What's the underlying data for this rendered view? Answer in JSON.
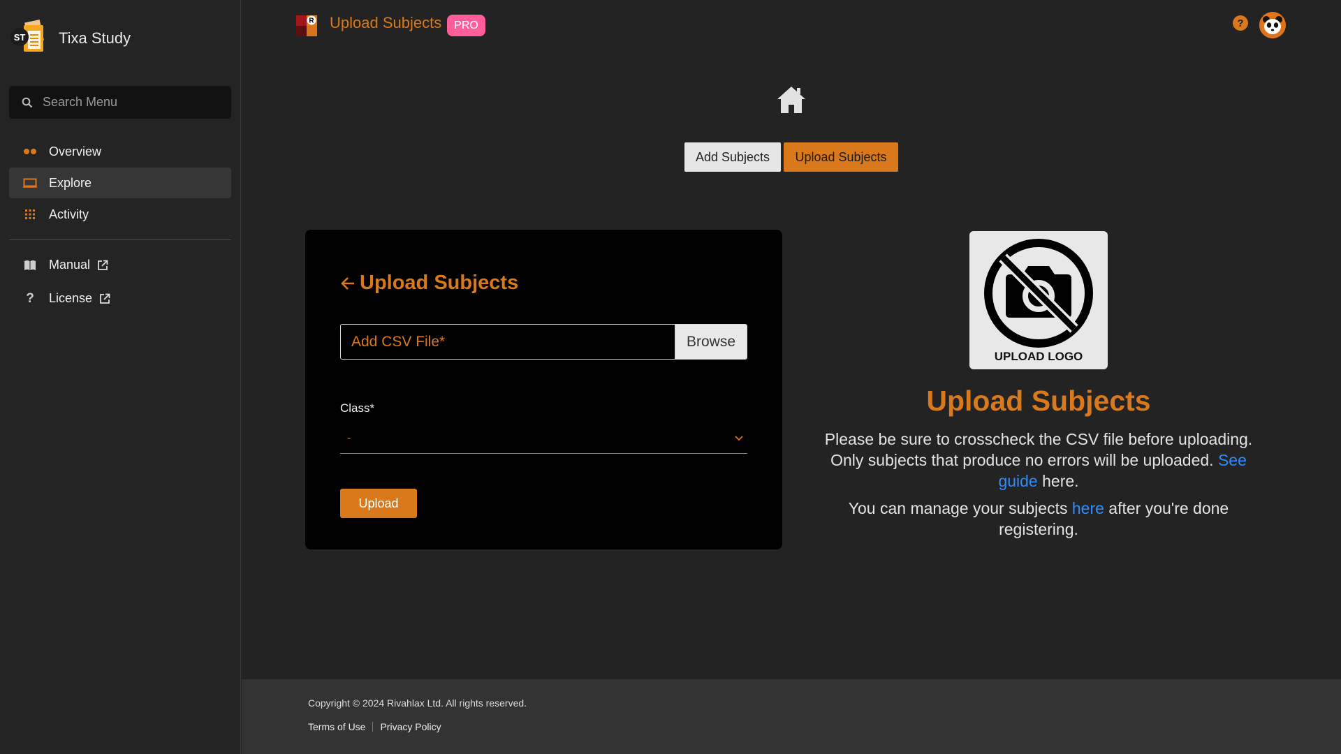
{
  "brand": {
    "name": "Tixa Study",
    "logo_initials": "ST"
  },
  "search": {
    "placeholder": "Search Menu"
  },
  "nav": {
    "items": [
      {
        "label": "Overview",
        "icon": "dots-icon"
      },
      {
        "label": "Explore",
        "icon": "monitor-icon",
        "active": true
      },
      {
        "label": "Activity",
        "icon": "grid-icon"
      }
    ],
    "secondary": [
      {
        "label": "Manual",
        "icon": "book-icon"
      },
      {
        "label": "License",
        "icon": "question-icon"
      }
    ]
  },
  "header": {
    "title": "Upload Subjects",
    "badge": "PRO",
    "icon_letter": "R",
    "help": "?"
  },
  "tabs": {
    "add": "Add Subjects",
    "upload": "Upload Subjects"
  },
  "form": {
    "title": "Upload Subjects",
    "file_placeholder": "Add CSV File*",
    "browse": "Browse",
    "class_label": "Class*",
    "class_value": "-",
    "submit": "Upload"
  },
  "info": {
    "logo_text": "UPLOAD LOGO",
    "title": "Upload Subjects",
    "p1_text": "Please be sure to crosscheck the CSV file before uploading. Only subjects that produce no errors will be uploaded. ",
    "p1_link": "See guide",
    "p1_tail": " here.",
    "p2_text": "You can manage your subjects ",
    "p2_link": "here",
    "p2_tail": " after you're done registering."
  },
  "footer": {
    "copyright": "Copyright © 2024 Rivahlax Ltd. All rights reserved.",
    "terms": "Terms of Use",
    "privacy": "Privacy Policy"
  },
  "colors": {
    "accent": "#d9791c",
    "badge": "#ff5e9a",
    "link": "#2f8cff"
  }
}
